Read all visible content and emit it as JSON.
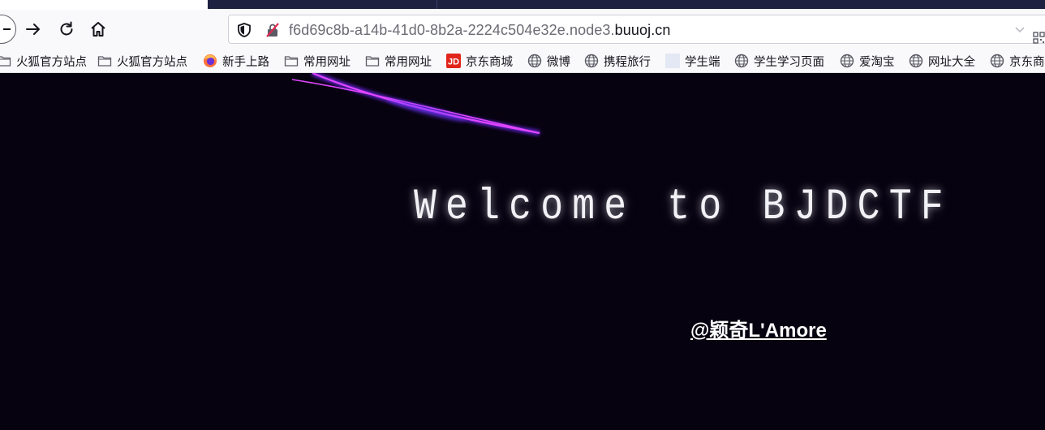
{
  "browser": {
    "url_prefix": "f6d69c8b-a14b-41d0-8b2a-2224c504e32e.node3.",
    "url_domain": "buuoj.cn",
    "nav_icons": [
      "back-arrow-icon",
      "forward-arrow-icon",
      "reload-icon",
      "home-icon"
    ]
  },
  "bookmarks": [
    {
      "label": "火狐官方站点",
      "icon": "folder-icon"
    },
    {
      "label": "火狐官方站点",
      "icon": "folder-icon"
    },
    {
      "label": "新手上路",
      "icon": "firefox-icon"
    },
    {
      "label": "常用网址",
      "icon": "folder-icon"
    },
    {
      "label": "常用网址",
      "icon": "folder-icon"
    },
    {
      "label": "京东商城",
      "icon": "jd-icon"
    },
    {
      "label": "微博",
      "icon": "globe-icon"
    },
    {
      "label": "携程旅行",
      "icon": "globe-icon"
    },
    {
      "label": "学生端",
      "icon": "blank-page-icon"
    },
    {
      "label": "学生学习页面",
      "icon": "globe-icon"
    },
    {
      "label": "爱淘宝",
      "icon": "globe-icon"
    },
    {
      "label": "网址大全",
      "icon": "globe-icon"
    },
    {
      "label": "京东商",
      "icon": "globe-icon"
    }
  ],
  "page": {
    "welcome": "Welcome to BJDCTF",
    "author": "@颖奇L'Amore"
  },
  "colors": {
    "page_background": "#06020f",
    "comet": "#d63bf5",
    "welcome_text": "#f1f1f6"
  }
}
